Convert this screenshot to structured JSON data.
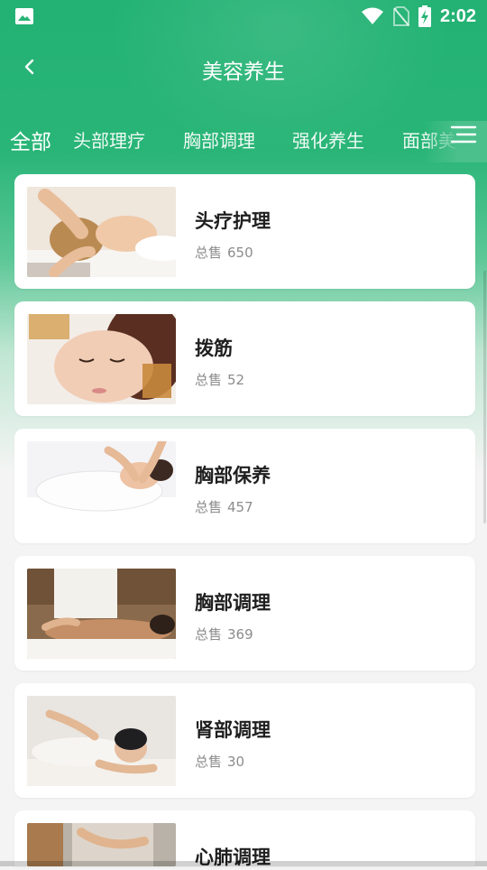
{
  "status_bar": {
    "time": "2:02",
    "left_icon": "image-icon",
    "icons": [
      "wifi-icon",
      "no-sim-icon",
      "battery-charging-icon"
    ]
  },
  "header": {
    "title": "美容养生",
    "back_icon": "back-arrow-icon"
  },
  "tabs": [
    {
      "label": "全部",
      "active": true
    },
    {
      "label": "头部理疗",
      "active": false
    },
    {
      "label": "胸部调理",
      "active": false
    },
    {
      "label": "强化养生",
      "active": false
    },
    {
      "label": "面部美",
      "active": false
    }
  ],
  "menu_icon": "menu-lines-icon",
  "sales_label": "总售",
  "items": [
    {
      "name": "头疗护理",
      "sales": "650"
    },
    {
      "name": "拨筋",
      "sales": "52"
    },
    {
      "name": "胸部保养",
      "sales": "457"
    },
    {
      "name": "胸部调理",
      "sales": "369"
    },
    {
      "name": "肾部调理",
      "sales": "30"
    },
    {
      "name": "心肺调理",
      "sales": ""
    }
  ],
  "colors": {
    "primary_green": "#23b274",
    "card_bg": "#ffffff",
    "title_text": "#1f1f1f",
    "muted_text": "#8c8c8c"
  }
}
